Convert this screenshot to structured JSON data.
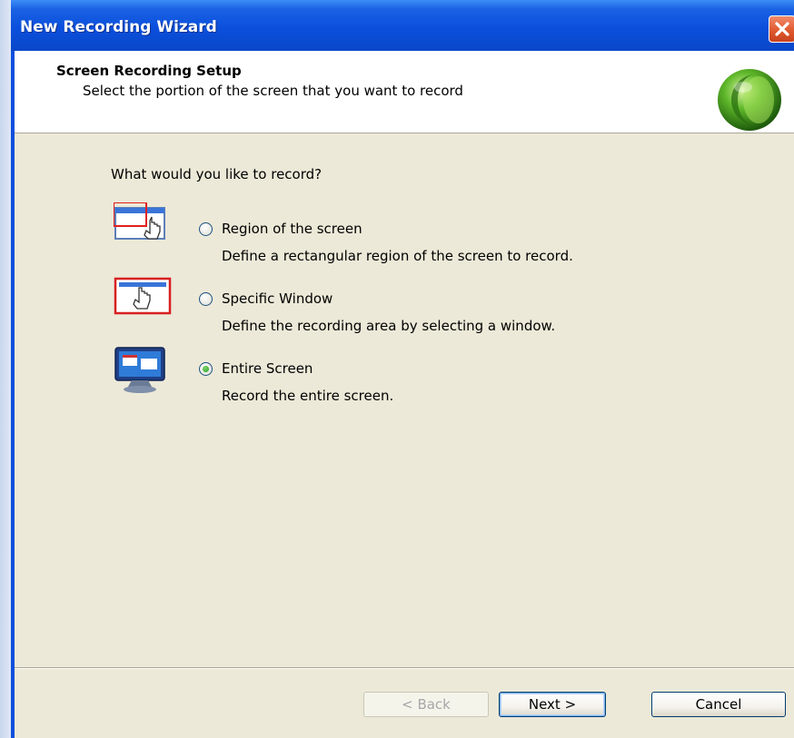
{
  "window": {
    "title": "New Recording Wizard"
  },
  "header": {
    "title": "Screen Recording Setup",
    "subtitle": "Select the portion of the screen that you want to record"
  },
  "main": {
    "question": "What would you like to record?",
    "options": [
      {
        "label": "Region of the screen",
        "description": "Define a rectangular region of the screen to record.",
        "selected": false,
        "icon": "region-select-icon"
      },
      {
        "label": "Specific Window",
        "description": "Define the recording area by selecting a window.",
        "selected": false,
        "icon": "window-select-icon"
      },
      {
        "label": "Entire Screen",
        "description": "Record the entire screen.",
        "selected": true,
        "icon": "monitor-icon"
      }
    ]
  },
  "footer": {
    "back_label": "< Back",
    "next_label": "Next >",
    "cancel_label": "Cancel"
  },
  "colors": {
    "titlebar": "#0b4fdc",
    "dialog_bg": "#ece9d8",
    "header_bg": "#ffffff",
    "close_button": "#e05a30",
    "radio_selected": "#21a121"
  }
}
